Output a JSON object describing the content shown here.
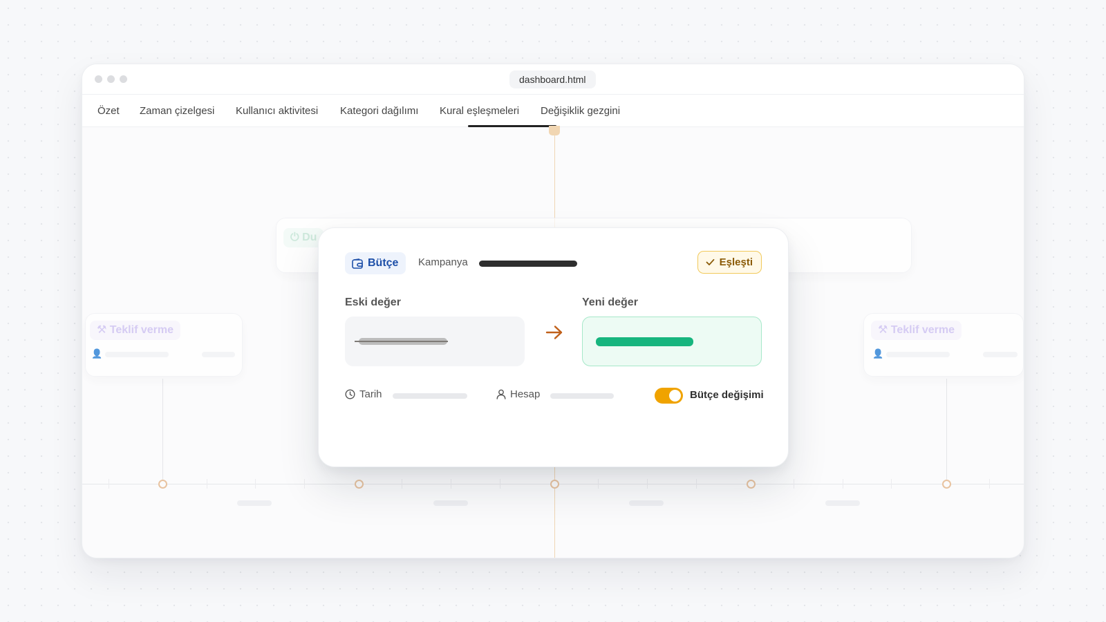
{
  "window": {
    "url": "dashboard.html"
  },
  "tabs": [
    {
      "label": "Özet"
    },
    {
      "label": "Zaman çizelgesi"
    },
    {
      "label": "Kullanıcı aktivitesi"
    },
    {
      "label": "Kategori dağılımı"
    },
    {
      "label": "Kural eşleşmeleri",
      "active": true
    },
    {
      "label": "Değişiklik gezgini"
    }
  ],
  "background": {
    "card_left": {
      "label": "Teklif verme",
      "icon": "gavel-icon"
    },
    "card_right": {
      "label": "Teklif verme",
      "icon": "gavel-icon"
    },
    "card_top": {
      "label": "Du",
      "icon": "power-icon"
    }
  },
  "detail": {
    "category": {
      "label": "Bütçe",
      "icon": "wallet-icon",
      "color": "#1d4fa8"
    },
    "entity_label": "Kampanya",
    "status_badge": {
      "label": "Eşleşti",
      "icon": "check-icon",
      "color": "#f1c95a"
    },
    "old_value_label": "Eski değer",
    "new_value_label": "Yeni değer",
    "new_value_color": "#17b57e",
    "meta": {
      "date_label": "Tarih",
      "account_label": "Hesap"
    },
    "toggle": {
      "label": "Bütçe değişimi",
      "on": true,
      "color": "#f0a300"
    }
  }
}
